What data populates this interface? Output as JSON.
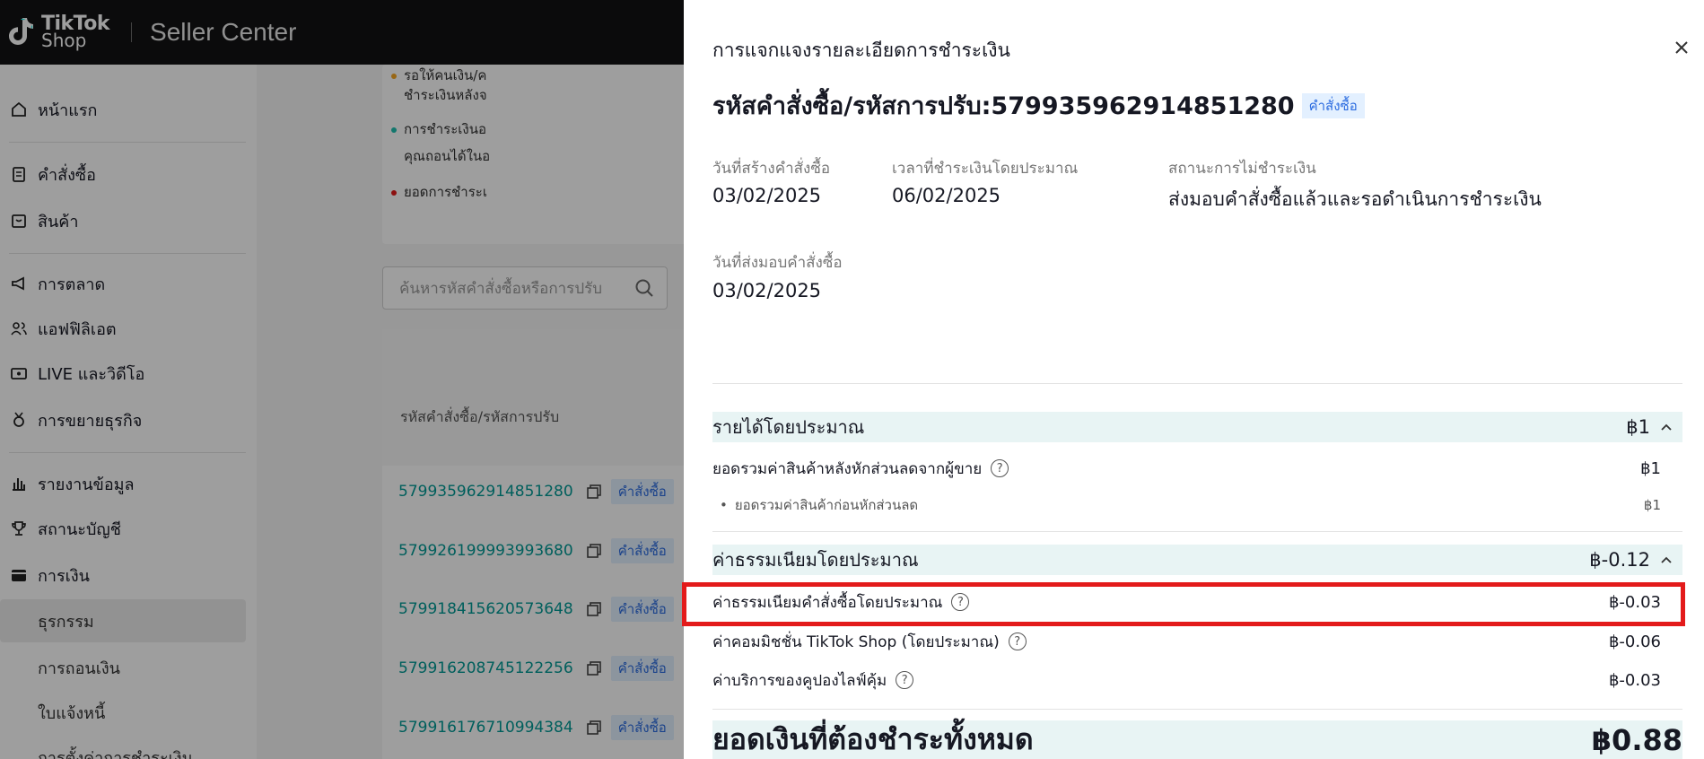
{
  "header": {
    "logo_line1": "TikTok",
    "logo_line2": "Shop",
    "app_name": "Seller Center"
  },
  "sidebar": {
    "items": [
      {
        "label": "หน้าแรก",
        "icon": "home-icon"
      },
      {
        "label": "คำสั่งซื้อ",
        "icon": "clipboard-icon"
      },
      {
        "label": "สินค้า",
        "icon": "box-icon"
      },
      {
        "label": "การตลาด",
        "icon": "megaphone-icon"
      },
      {
        "label": "แอฟฟิลิเอต",
        "icon": "people-icon"
      },
      {
        "label": "LIVE และวิดีโอ",
        "icon": "video-icon"
      },
      {
        "label": "การขยายธุรกิจ",
        "icon": "medal-icon"
      },
      {
        "label": "รายงานข้อมูล",
        "icon": "bar-chart-icon"
      },
      {
        "label": "สถานะบัญชี",
        "icon": "trophy-icon"
      },
      {
        "label": "การเงิน",
        "icon": "wallet-icon"
      }
    ],
    "sub_items": [
      "ธุรกรรม",
      "การถอนเงิน",
      "ใบแจ้งหนี้",
      "การตั้งค่าการชำระเงิน"
    ]
  },
  "main": {
    "notices": [
      "รอให้คนเงิน/ค",
      "ชำระเงินหลังจ",
      "การชำระเงินอ",
      "คุณถอนได้ในอ",
      "ยอดการชำระเ"
    ],
    "search_placeholder": "ค้นหารหัสคำสั่งซื้อหรือการปรับ",
    "table_header": "รหัสคำสั่งซื้อ/รหัสการปรับ",
    "rows": [
      {
        "id": "579935962914851280",
        "tag": "คำสั่งซื้อ"
      },
      {
        "id": "579926199993993680",
        "tag": "คำสั่งซื้อ"
      },
      {
        "id": "579918415620573648",
        "tag": "คำสั่งซื้อ"
      },
      {
        "id": "579916208745122256",
        "tag": "คำสั่งซื้อ"
      },
      {
        "id": "579916176710994384",
        "tag": "คำสั่งซื้อ"
      }
    ]
  },
  "drawer": {
    "title": "การแจกแจงรายละเอียดการชำระเงิน",
    "order_heading": "รหัสคำสั่งซื้อ/รหัสการปรับ:579935962914851280",
    "order_tag": "คำสั่งซื้อ",
    "meta": {
      "created_label": "วันที่สร้างคำสั่งซื้อ",
      "created_value": "03/02/2025",
      "est_pay_label": "เวลาที่ชำระเงินโดยประมาณ",
      "est_pay_value": "06/02/2025",
      "status_label": "สถานะการไม่ชำระเงิน",
      "status_value": "ส่งมอบคำสั่งซื้อแล้วและรอดำเนินการชำระเงิน",
      "delivered_label": "วันที่ส่งมอบคำสั่งซื้อ",
      "delivered_value": "03/02/2025"
    },
    "revenue": {
      "label": "รายได้โดยประมาณ",
      "amount": "฿1",
      "items": [
        {
          "label": "ยอดรวมค่าสินค้าหลังหักส่วนลดจากผู้ขาย",
          "amount": "฿1"
        },
        {
          "label": "ยอดรวมค่าสินค้าก่อนหักส่วนลด",
          "amount": "฿1"
        }
      ]
    },
    "fees": {
      "label": "ค่าธรรมเนียมโดยประมาณ",
      "amount": "฿-0.12",
      "items": [
        {
          "label": "ค่าธรรมเนียมคำสั่งซื้อโดยประมาณ",
          "amount": "฿-0.03"
        },
        {
          "label": "ค่าคอมมิชชั่น TikTok Shop (โดยประมาณ)",
          "amount": "฿-0.06"
        },
        {
          "label": "ค่าบริการของคูปองไลฟ์คุ้ม",
          "amount": "฿-0.03"
        }
      ]
    },
    "total": {
      "label": "ยอดเงินที่ต้องชำระทั้งหมด",
      "amount": "฿0.88"
    },
    "help_glyph": "?"
  },
  "colors": {
    "topbar": "#121314",
    "link_teal": "#009995",
    "tag_bg": "#e3f0ff",
    "tag_text": "#2c6ce0",
    "section_bg": "#e8f4f4",
    "highlight": "#e31b1b"
  }
}
